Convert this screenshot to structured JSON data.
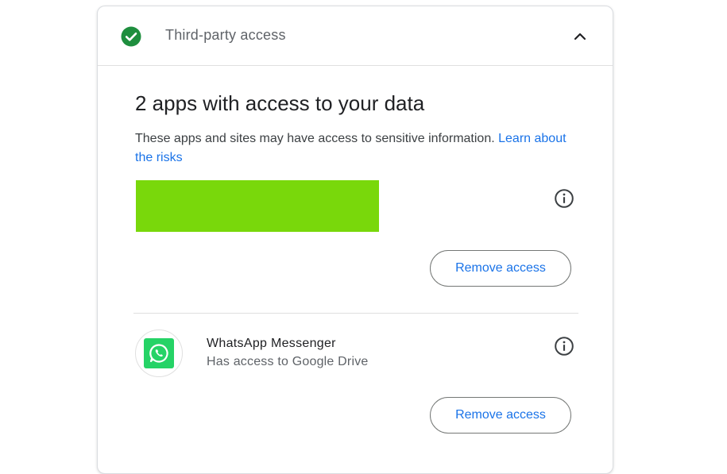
{
  "header": {
    "title": "Third-party access",
    "status_icon": "check-circle-icon",
    "status_color": "#1e8e3e",
    "toggle_icon": "chevron-up-icon"
  },
  "main": {
    "heading": "2 apps with access to your data",
    "description": "These apps and sites may have access to sensitive information.",
    "learn_link": "Learn about the risks",
    "link_color": "#1a73e8"
  },
  "apps": [
    {
      "name": "",
      "redacted": true,
      "redaction_color": "#79d80b",
      "info_icon": "info-icon",
      "remove_label": "Remove access"
    },
    {
      "name": "WhatsApp Messenger",
      "subtitle": "Has access to Google Drive",
      "logo_icon": "whatsapp-icon",
      "logo_color": "#25d366",
      "info_icon": "info-icon",
      "remove_label": "Remove access"
    }
  ]
}
